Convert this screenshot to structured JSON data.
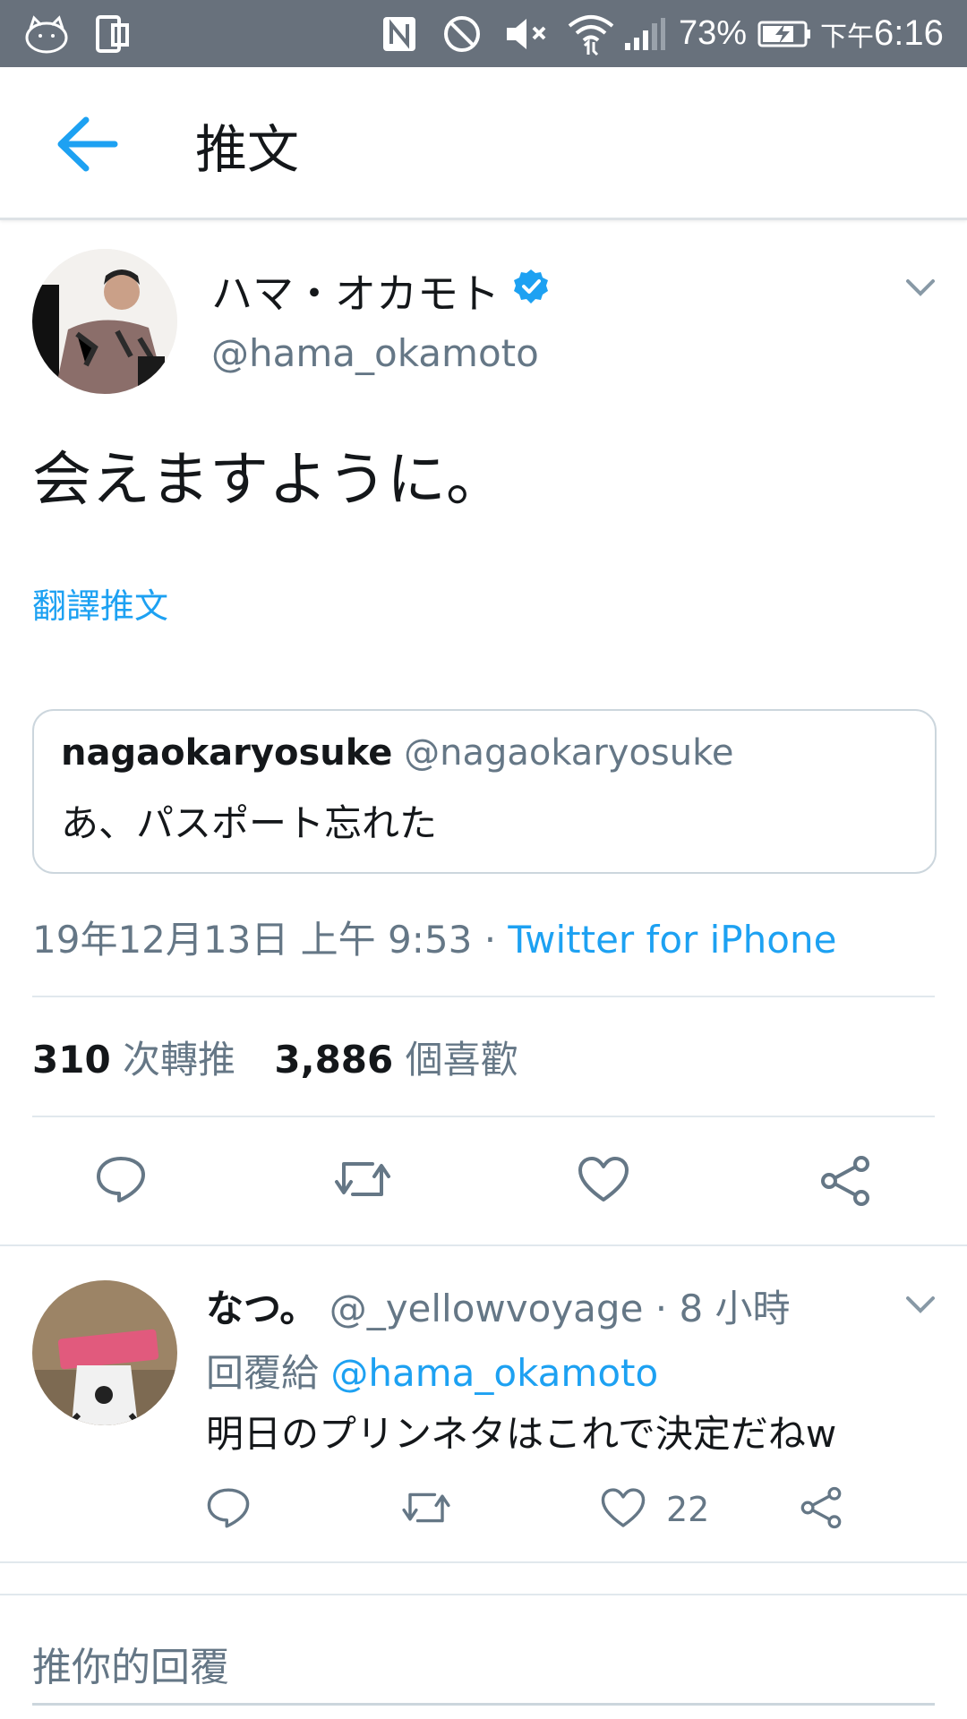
{
  "status_bar": {
    "battery": "73%",
    "time_prefix": "下午",
    "time": "6:16",
    "icons": [
      "cat-icon",
      "phone-icon",
      "nfc-icon",
      "do-not-disturb-icon",
      "mute-icon",
      "wifi-icon",
      "signal-icon",
      "battery-charging-icon"
    ]
  },
  "app_bar": {
    "title": "推文",
    "back_icon": "arrow-left-icon"
  },
  "tweet": {
    "display_name": "ハマ・オカモト",
    "handle": "@hama_okamoto",
    "verified": true,
    "text": "会えますように。",
    "translate_label": "翻譯推文",
    "quoted": {
      "display_name": "nagaokaryosuke",
      "handle": "@nagaokaryosuke",
      "text": "あ、パスポート忘れた"
    },
    "date": "19年12月13日 上午 9:53",
    "separator": " · ",
    "source": "Twitter for iPhone",
    "retweet_count": "310",
    "retweet_label": "次轉推",
    "like_count": "3,886",
    "like_label": "個喜歡"
  },
  "reply": {
    "display_name": "なつ。",
    "handle": "@_yellowvoyage",
    "time": " · 8 小時",
    "reply_to_label": "回覆給",
    "reply_to_handle": "@hama_okamoto",
    "text": "明日のプリンネタはこれで決定だねw",
    "like_count": "22"
  },
  "composer": {
    "placeholder": "推你的回覆"
  },
  "colors": {
    "accent": "#1da1f2",
    "status_bar": "#68717c",
    "secondary_text": "#657786"
  }
}
